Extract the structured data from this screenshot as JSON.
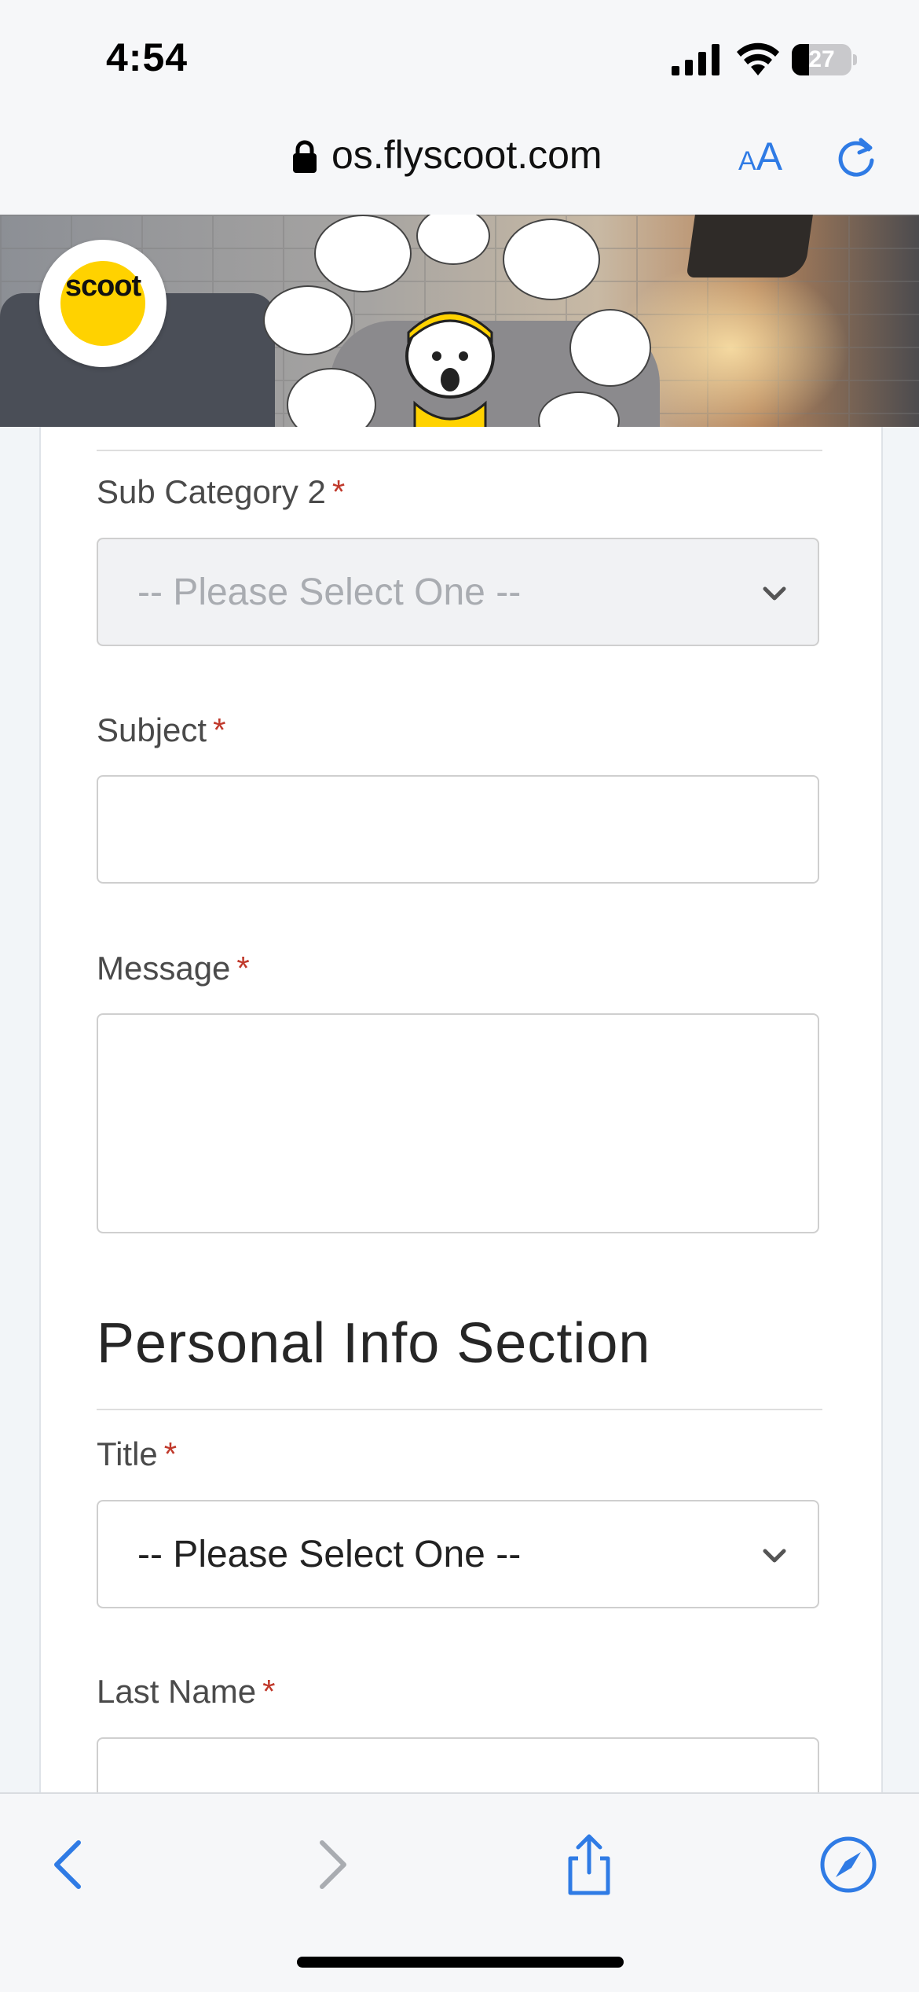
{
  "status_bar": {
    "time": "4:54",
    "battery": "27"
  },
  "browser": {
    "url": "os.flyscoot.com",
    "text_size_label_small": "A",
    "text_size_label_large": "A"
  },
  "brand": {
    "logo_text": "scoot",
    "accent": "#ffd200"
  },
  "form": {
    "sub_category_2": {
      "label": "Sub Category 2",
      "required": "*",
      "selected": "-- Please Select One --",
      "disabled": true
    },
    "subject": {
      "label": "Subject",
      "required": "*",
      "value": ""
    },
    "message": {
      "label": "Message",
      "required": "*",
      "value": ""
    },
    "personal_section_title": "Personal Info Section",
    "title": {
      "label": "Title",
      "required": "*",
      "selected": "-- Please Select One --"
    },
    "last_name": {
      "label": "Last Name",
      "required": "*",
      "value": ""
    }
  },
  "colors": {
    "required": "#c0392b",
    "ios_blue": "#2f7be5"
  },
  "icons": [
    "lock-icon",
    "reload-icon",
    "chevron-down-icon",
    "back-icon",
    "forward-icon",
    "share-icon",
    "compass-icon"
  ]
}
